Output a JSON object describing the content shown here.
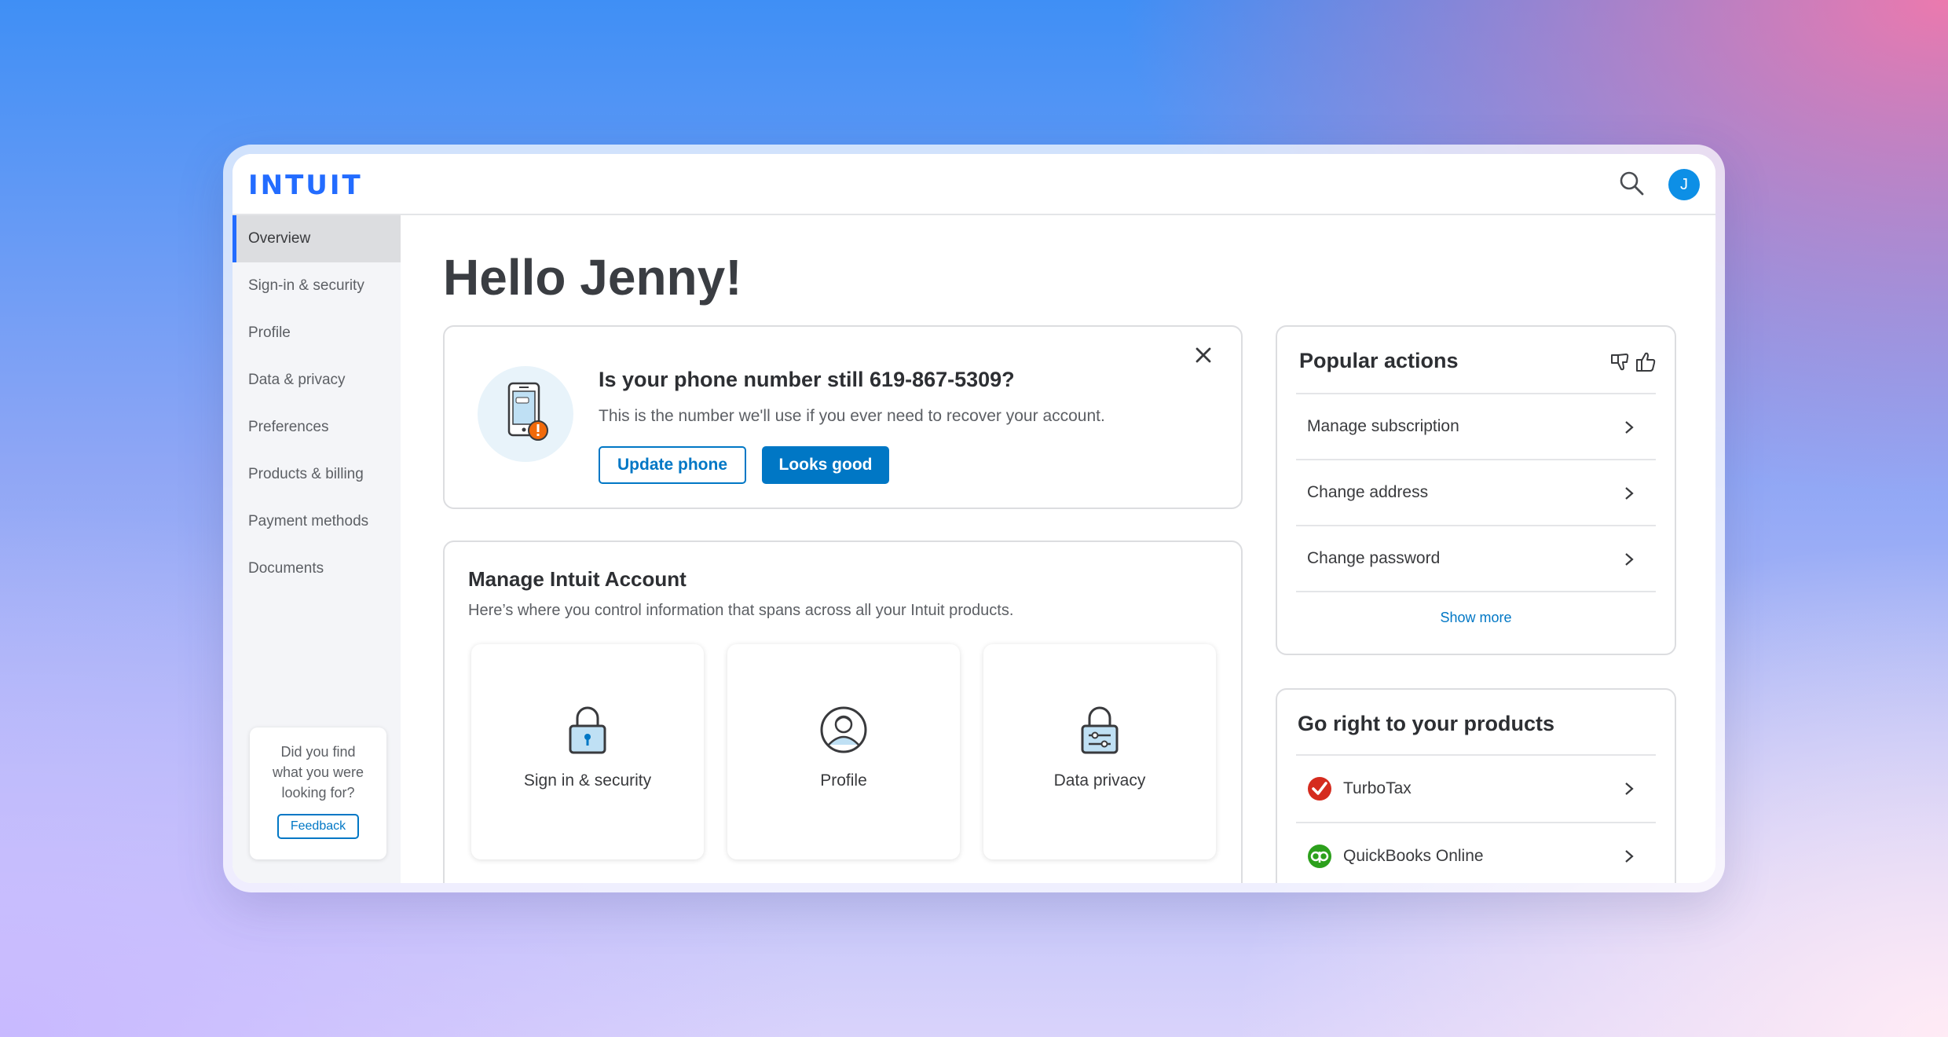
{
  "header": {
    "logo": "INTUIT",
    "avatar_initial": "J"
  },
  "sidebar": {
    "items": [
      {
        "label": "Overview",
        "active": true
      },
      {
        "label": "Sign-in & security"
      },
      {
        "label": "Profile"
      },
      {
        "label": "Data & privacy"
      },
      {
        "label": "Preferences"
      },
      {
        "label": "Products & billing"
      },
      {
        "label": "Payment methods"
      },
      {
        "label": "Documents"
      }
    ],
    "feedback": {
      "line1": "Did you find",
      "line2": "what you were",
      "line3": "looking for?",
      "button": "Feedback"
    }
  },
  "main": {
    "greeting": "Hello Jenny!",
    "phone_card": {
      "title": "Is your phone number still 619-867-5309?",
      "subtitle": "This is the number we'll use if you ever need to recover your account.",
      "update_button": "Update phone",
      "confirm_button": "Looks good"
    },
    "manage_card": {
      "title": "Manage Intuit Account",
      "subtitle": "Here’s where you control information that spans across all your Intuit products.",
      "tiles": [
        {
          "label": "Sign in & security",
          "icon": "lock-icon"
        },
        {
          "label": "Profile",
          "icon": "person-icon"
        },
        {
          "label": "Data privacy",
          "icon": "privacy-lock-icon"
        }
      ]
    },
    "popular_actions": {
      "title": "Popular actions",
      "items": [
        "Manage subscription",
        "Change address",
        "Change password"
      ],
      "show_more": "Show more"
    },
    "products": {
      "title": "Go right to your products",
      "items": [
        {
          "name": "TurboTax",
          "icon": "turbotax-logo-icon",
          "color": "#d52b1e"
        },
        {
          "name": "QuickBooks Online",
          "icon": "quickbooks-logo-icon",
          "color": "#2ca01c"
        }
      ]
    }
  },
  "colors": {
    "brand": "#236cff",
    "action": "#0077c5",
    "avatar": "#0d8fe6"
  }
}
